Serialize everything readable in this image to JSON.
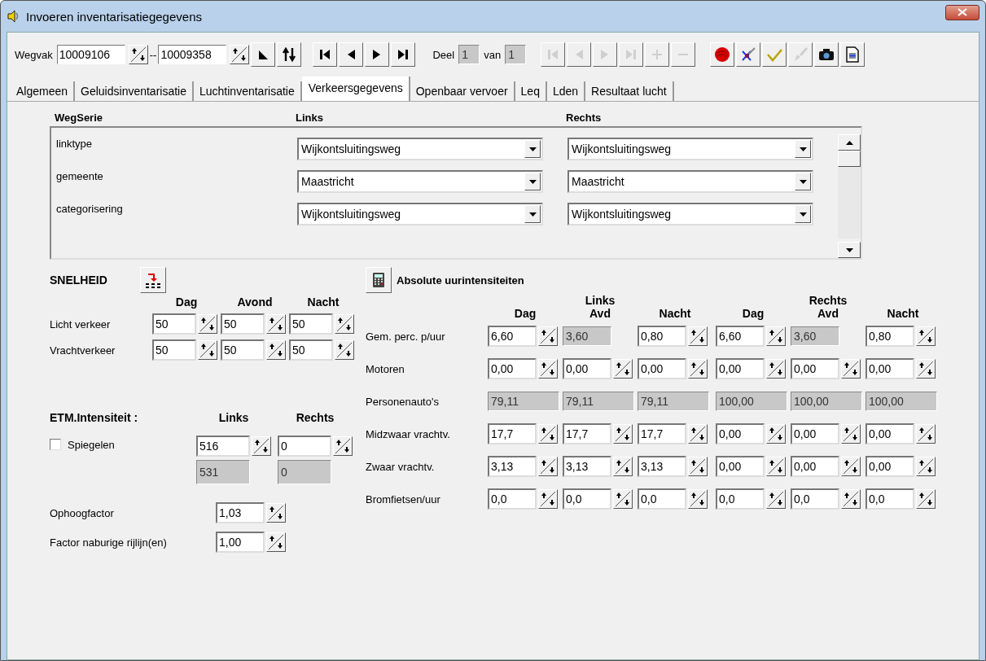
{
  "window": {
    "title": "Invoeren inventarisatiegegevens"
  },
  "toolbar": {
    "wegvak_label": "Wegvak",
    "wegvak_from": "10009106",
    "separator": "--",
    "wegvak_to": "10009358",
    "tools": [
      {
        "kind": "corner",
        "disabled": false
      },
      {
        "kind": "swap",
        "disabled": false
      }
    ],
    "nav": [
      {
        "kind": "first",
        "disabled": false
      },
      {
        "kind": "prev",
        "disabled": false
      },
      {
        "kind": "next",
        "disabled": false
      },
      {
        "kind": "last",
        "disabled": false
      }
    ],
    "deel_label": "Deel",
    "deel_value": "1",
    "van_label": "van",
    "van_value": "1",
    "record_nav": [
      {
        "kind": "first",
        "disabled": true
      },
      {
        "kind": "prev",
        "disabled": true
      },
      {
        "kind": "next",
        "disabled": true
      },
      {
        "kind": "last",
        "disabled": true
      },
      {
        "kind": "add",
        "disabled": true
      },
      {
        "kind": "remove",
        "disabled": true
      }
    ],
    "actions": [
      {
        "kind": "record",
        "disabled": false
      },
      {
        "kind": "cancel",
        "disabled": false
      },
      {
        "kind": "confirm",
        "disabled": false
      },
      {
        "kind": "clean",
        "disabled": true
      },
      {
        "kind": "camera",
        "disabled": false
      },
      {
        "kind": "document",
        "disabled": false
      }
    ]
  },
  "tabs": [
    {
      "label": "Algemeen",
      "selected": false
    },
    {
      "label": "Geluidsinventarisatie",
      "selected": false
    },
    {
      "label": "Luchtinventarisatie",
      "selected": false
    },
    {
      "label": "Verkeersgegevens",
      "selected": true
    },
    {
      "label": "Openbaar vervoer",
      "selected": false
    },
    {
      "label": "Leq",
      "selected": false
    },
    {
      "label": "Lden",
      "selected": false
    },
    {
      "label": "Resultaat lucht",
      "selected": false
    }
  ],
  "wegserie": {
    "headers": [
      "WegSerie",
      "Links",
      "Rechts"
    ],
    "rows": [
      {
        "label": "linktype",
        "links": "Wijkontsluitingsweg",
        "rechts": "Wijkontsluitingsweg"
      },
      {
        "label": "gemeente",
        "links": "Maastricht",
        "rechts": "Maastricht"
      },
      {
        "label": "categorisering",
        "links": "Wijkontsluitingsweg",
        "rechts": "Wijkontsluitingsweg"
      }
    ]
  },
  "snelheid": {
    "title": "SNELHEID",
    "columns": [
      "Dag",
      "Avond",
      "Nacht"
    ],
    "rows": [
      {
        "label": "Licht verkeer",
        "values": [
          "50",
          "50",
          "50"
        ]
      },
      {
        "label": "Vrachtverkeer",
        "values": [
          "50",
          "50",
          "50"
        ]
      }
    ]
  },
  "etm": {
    "title": "ETM.Intensiteit :",
    "columns": [
      "Links",
      "Rechts"
    ],
    "spiegelen": {
      "label": "Spiegelen",
      "checked": false
    },
    "inputs": [
      "516",
      "0"
    ],
    "computed": [
      "531",
      "0"
    ]
  },
  "factors": [
    {
      "label": "Ophoogfactor",
      "value": "1,03"
    },
    {
      "label": "Factor naburige rijlijn(en)",
      "value": "1,00"
    }
  ],
  "uur": {
    "title": "Absolute uurintensiteiten",
    "groups": [
      "Links",
      "Rechts"
    ],
    "columns": [
      "Dag",
      "Avd",
      "Nacht",
      "Dag",
      "Avd",
      "Nacht"
    ],
    "rows": [
      {
        "label": "Gem. perc. p/uur",
        "cells": [
          {
            "kind": "spin",
            "value": "6,60"
          },
          {
            "kind": "fixed",
            "value": "3,60"
          },
          {
            "kind": "spin",
            "value": "0,80"
          },
          {
            "kind": "spin",
            "value": "6,60"
          },
          {
            "kind": "fixed",
            "value": "3,60"
          },
          {
            "kind": "spin",
            "value": "0,80"
          }
        ]
      },
      {
        "label": "Motoren",
        "cells": [
          {
            "kind": "spin",
            "value": "0,00"
          },
          {
            "kind": "spin",
            "value": "0,00"
          },
          {
            "kind": "spin",
            "value": "0,00"
          },
          {
            "kind": "spin",
            "value": "0,00"
          },
          {
            "kind": "spin",
            "value": "0,00"
          },
          {
            "kind": "spin",
            "value": "0,00"
          }
        ]
      },
      {
        "label": "Personenauto's",
        "cells": [
          {
            "kind": "total",
            "value": "79,11"
          },
          {
            "kind": "total",
            "value": "79,11"
          },
          {
            "kind": "total",
            "value": "79,11"
          },
          {
            "kind": "total",
            "value": "100,00"
          },
          {
            "kind": "total",
            "value": "100,00"
          },
          {
            "kind": "total",
            "value": "100,00"
          }
        ]
      },
      {
        "label": "Midzwaar vrachtv.",
        "cells": [
          {
            "kind": "spin",
            "value": "17,7"
          },
          {
            "kind": "spin",
            "value": "17,7"
          },
          {
            "kind": "spin",
            "value": "17,7"
          },
          {
            "kind": "spin",
            "value": "0,00"
          },
          {
            "kind": "spin",
            "value": "0,00"
          },
          {
            "kind": "spin",
            "value": "0,00"
          }
        ]
      },
      {
        "label": "Zwaar vrachtv.",
        "cells": [
          {
            "kind": "spin",
            "value": "3,13"
          },
          {
            "kind": "spin",
            "value": "3,13"
          },
          {
            "kind": "spin",
            "value": "3,13"
          },
          {
            "kind": "spin",
            "value": "0,00"
          },
          {
            "kind": "spin",
            "value": "0,00"
          },
          {
            "kind": "spin",
            "value": "0,00"
          }
        ]
      },
      {
        "label": "Bromfietsen/uur",
        "cells": [
          {
            "kind": "spin",
            "value": "0,0"
          },
          {
            "kind": "spin",
            "value": "0,0"
          },
          {
            "kind": "spin",
            "value": "0,0"
          },
          {
            "kind": "spin",
            "value": "0,0"
          },
          {
            "kind": "spin",
            "value": "0,0"
          },
          {
            "kind": "spin",
            "value": "0,0"
          }
        ]
      }
    ]
  }
}
